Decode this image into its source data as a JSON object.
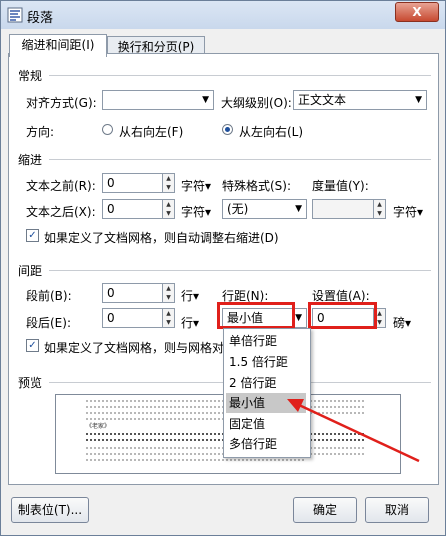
{
  "window": {
    "title": "段落",
    "close_label": "X"
  },
  "tabs": [
    {
      "label": "缩进和间距(I)"
    },
    {
      "label": "换行和分页(P)"
    }
  ],
  "general": {
    "section": "常规",
    "align_label": "对齐方式(G):",
    "align_value": "",
    "outline_label": "大纲级别(O):",
    "outline_value": "正文文本",
    "direction_label": "方向:",
    "rtl_label": "从右向左(F)",
    "ltr_label": "从左向右(L)"
  },
  "indent": {
    "section": "缩进",
    "before_label": "文本之前(R):",
    "before_value": "0",
    "before_unit": "字符",
    "after_label": "文本之后(X):",
    "after_value": "0",
    "after_unit": "字符",
    "special_label": "特殊格式(S):",
    "special_value": "(无)",
    "measure_label": "度量值(Y):",
    "measure_value": "",
    "measure_unit": "字符",
    "grid_check_label": "如果定义了文档网格，则自动调整右缩进(D)"
  },
  "spacing": {
    "section": "间距",
    "before_label": "段前(B):",
    "before_value": "0",
    "before_unit": "行",
    "after_label": "段后(E):",
    "after_value": "0",
    "after_unit": "行",
    "line_label": "行距(N):",
    "line_value": "最小值",
    "set_label": "设置值(A):",
    "set_value": "0",
    "set_unit": "磅",
    "grid_check_label": "如果定义了文档网格，则与网格对"
  },
  "line_spacing_options": [
    "单倍行距",
    "1.5 倍行距",
    "2 倍行距",
    "最小值",
    "固定值",
    "多倍行距"
  ],
  "line_spacing_selected": 3,
  "preview": {
    "section": "预览",
    "sample_label": "《老家》"
  },
  "footer": {
    "tabs_button": "制表位(T)...",
    "ok_button": "确定",
    "cancel_button": "取消"
  },
  "colors": {
    "highlight": "#e0201b",
    "accent": "#1e4f9c"
  }
}
